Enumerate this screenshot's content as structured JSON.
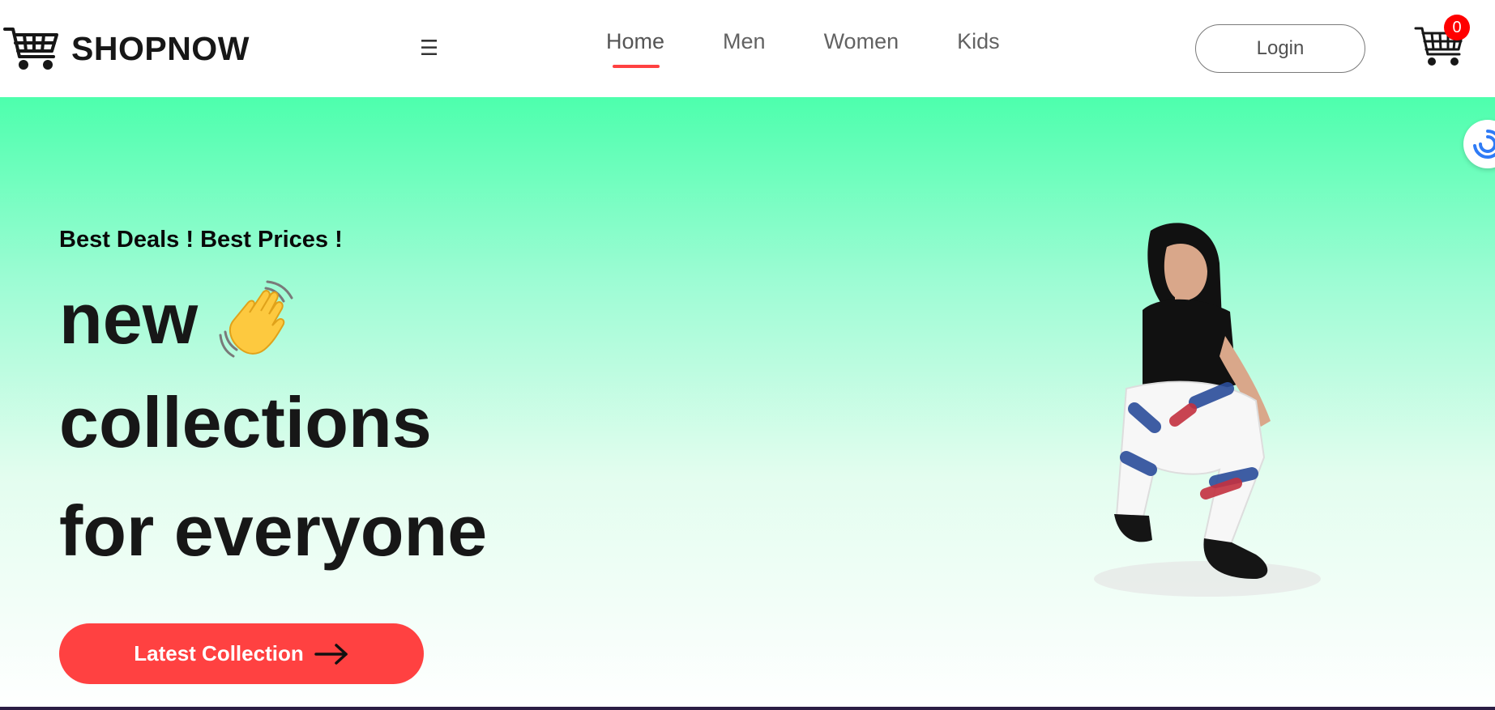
{
  "brand": {
    "name": "SHOPNOW",
    "logo_icon": "shopping-cart-icon"
  },
  "nav": {
    "menu_icon": "hamburger-menu-icon",
    "hamburger_glyph": "☰",
    "items": [
      {
        "label": "Home",
        "active": true
      },
      {
        "label": "Men",
        "active": false
      },
      {
        "label": "Women",
        "active": false
      },
      {
        "label": "Kids",
        "active": false
      }
    ],
    "login_label": "Login",
    "cart_count": "0",
    "cart_icon": "shopping-cart-icon"
  },
  "hero": {
    "tagline": "Best Deals ! Best Prices !",
    "line1": "new",
    "line2": "collections",
    "line3": "for everyone",
    "wave_icon": "waving-hand-icon",
    "cta_label": "Latest Collection",
    "cta_icon": "arrow-right-icon"
  },
  "colors": {
    "accent": "#ff4141",
    "hero_gradient_top": "#4dffad",
    "hero_gradient_bottom": "#ffffff",
    "text_dark": "#171717",
    "nav_text": "#626262",
    "badge": "#ff0000"
  },
  "floating_widget_icon": "assistant-swirl-icon"
}
